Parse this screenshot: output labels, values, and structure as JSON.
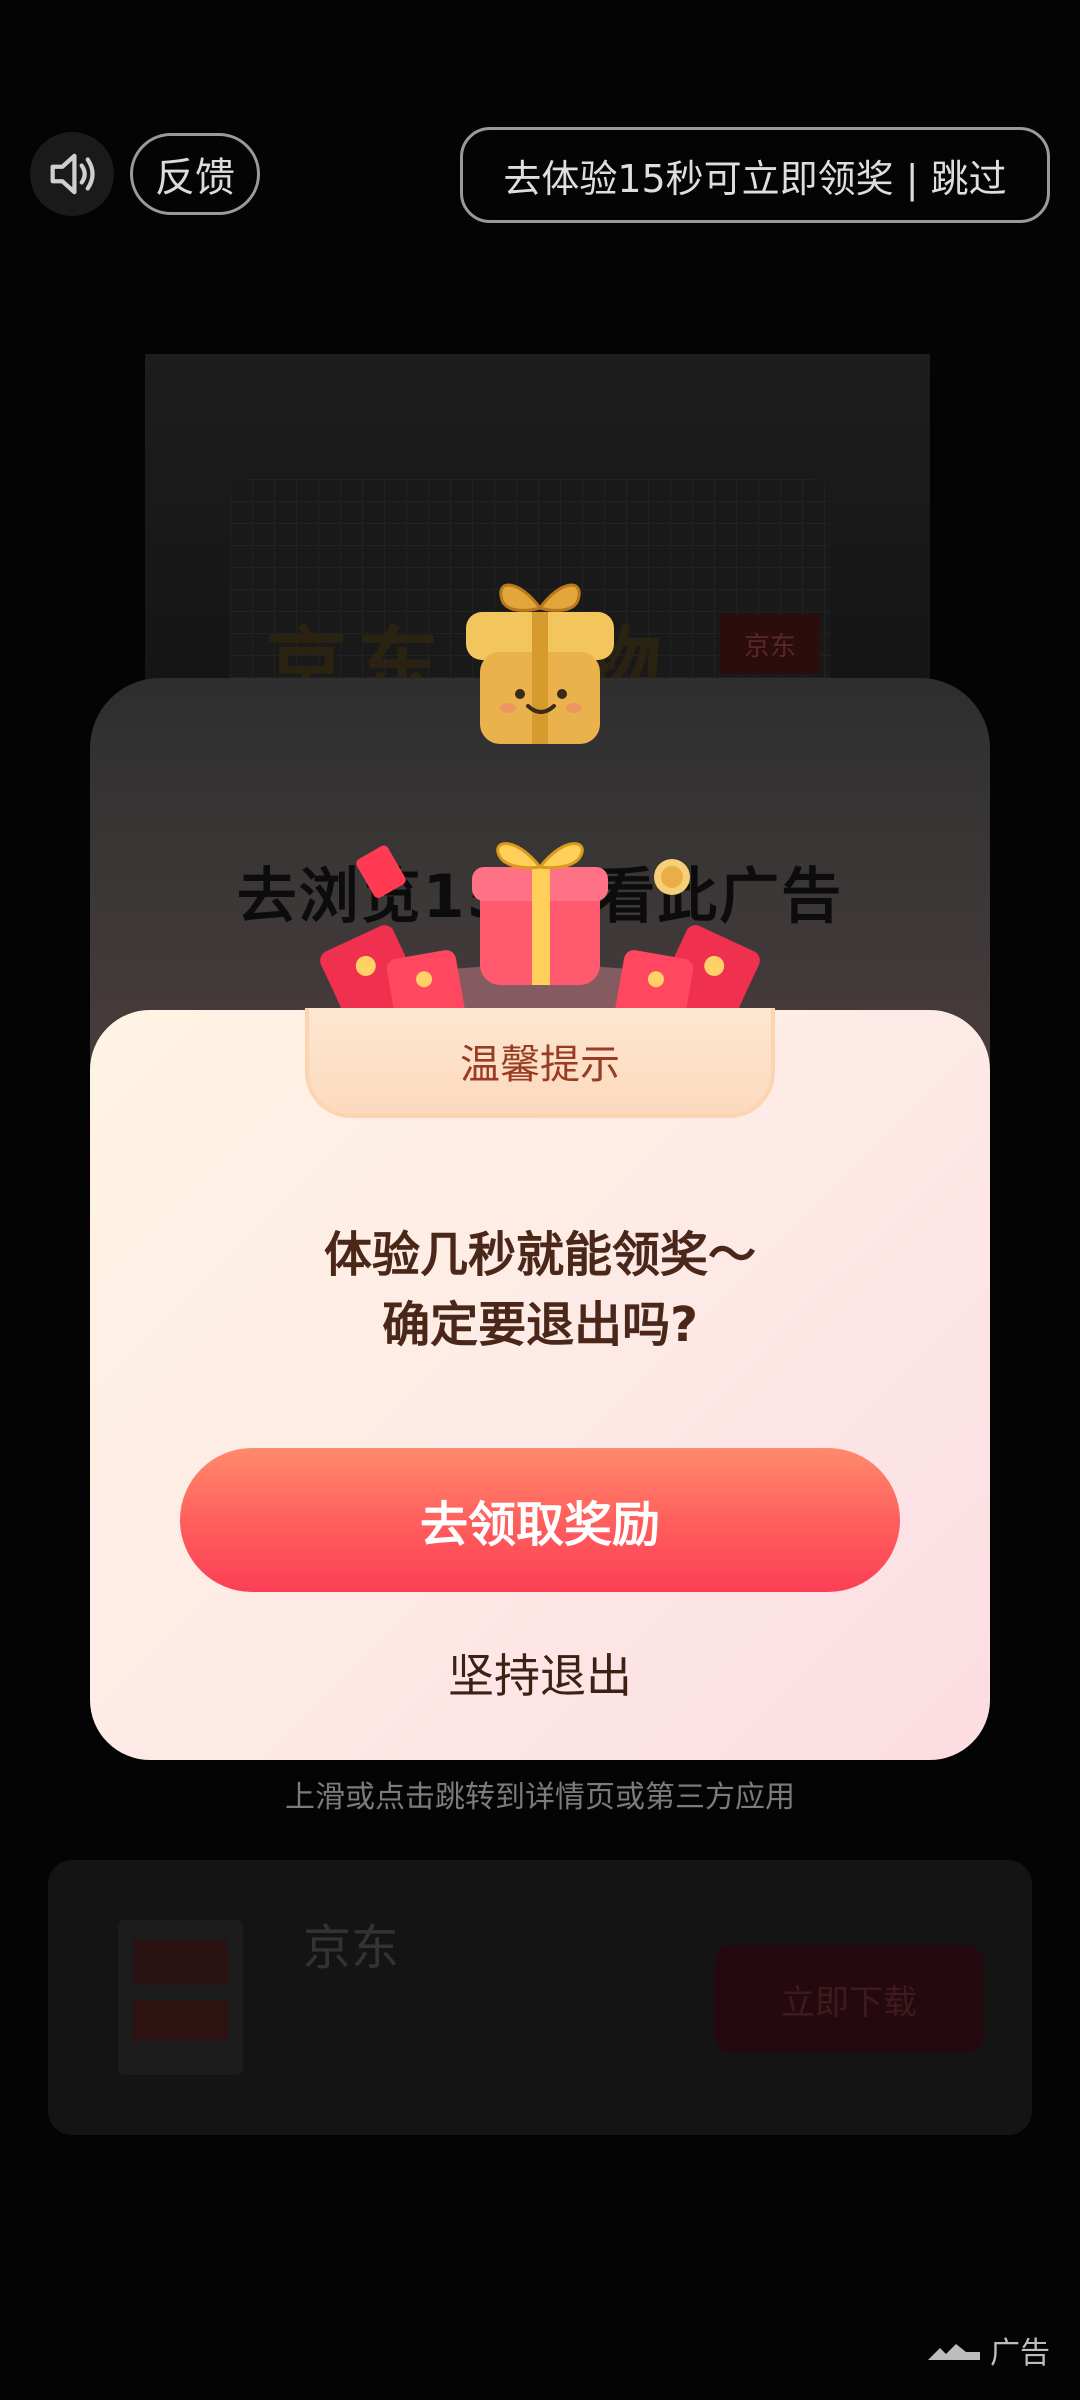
{
  "colors": {
    "accent": "#ff5c5c",
    "dialog_text": "#4a2718",
    "tab_text": "#9a3b23"
  },
  "top_bar": {
    "sound_icon": "speaker-icon",
    "feedback_label": "反馈",
    "skip_label": "去体验15秒可立即领奖 | 跳过"
  },
  "background_ad": {
    "headline": "京东      好物",
    "brand_tag": "京东",
    "hint": "上滑或点击跳转到详情页或第三方应用",
    "app_name": "京东",
    "download_label": "立即下载",
    "ad_mark": "广告"
  },
  "back_dialog": {
    "title": "去浏览15秒 看此广告"
  },
  "dialog": {
    "tab_title": "温馨提示",
    "message_line1": "体验几秒就能领奖～",
    "message_line2": "确定要退出吗?",
    "claim_label": "去领取奖励",
    "quit_label": "坚持退出"
  }
}
